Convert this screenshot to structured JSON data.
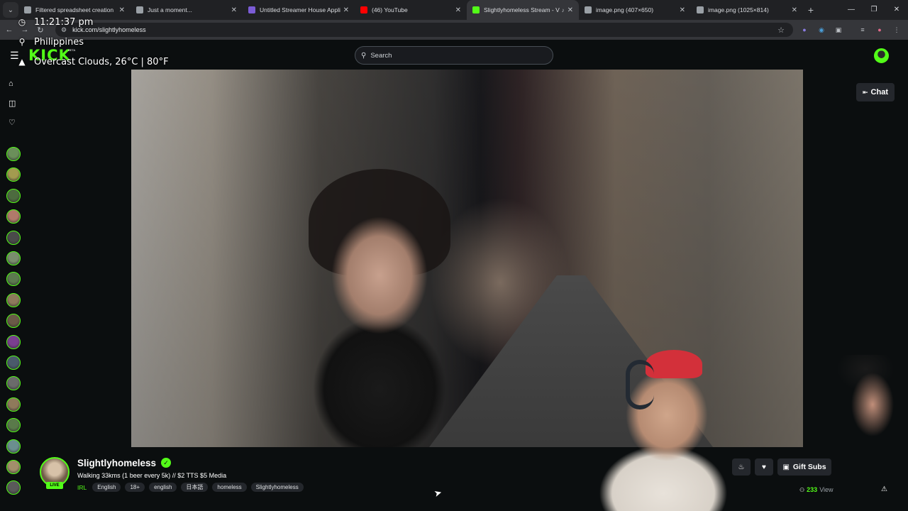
{
  "browser": {
    "tabs": [
      {
        "title": "Filtered spreadsheet creation",
        "favicon_color": "#9aa0a6"
      },
      {
        "title": "Just a moment...",
        "favicon_color": "#9aa0a6"
      },
      {
        "title": "Untitled Streamer House Appli",
        "favicon_color": "#7b5cd6"
      },
      {
        "title": "(46) YouTube",
        "favicon_color": "#ff0000"
      },
      {
        "title": "Slightlyhomeless Stream - V",
        "favicon_color": "#53fc18",
        "active": true
      },
      {
        "title": "image.png (407×650)",
        "favicon_color": "#9aa0a6"
      },
      {
        "title": "image.png (1025×814)",
        "favicon_color": "#9aa0a6"
      }
    ],
    "url": "kick.com/slightlyhomeless"
  },
  "overlay": {
    "time": "11:21:37 pm",
    "location": "Philippines",
    "weather": "Overcast Clouds, 26°C | 80°F"
  },
  "header": {
    "logo": "KICK",
    "beta": "BETA",
    "search_placeholder": "Search"
  },
  "sidebar": {
    "follow_colors": [
      "#6b8f5a",
      "#a39b4f",
      "#4d6b3f",
      "#b07a6a",
      "#4a4a4a",
      "#7a8d6e",
      "#5c7a4f",
      "#8e7a5b",
      "#6a5a47",
      "#7a3f8f",
      "#4a5a6b",
      "#6b6b6b",
      "#8f7a5b",
      "#5a7a4a",
      "#6b8f8f",
      "#a38f6b",
      "#5a5a5a"
    ]
  },
  "video_controls": {
    "chat_label": "Chat"
  },
  "stream": {
    "channel": "Slightlyhomeless",
    "live": "LIVE",
    "title": "Walking 33kms (1 beer every 5k) //  $2 TTS $5 Media",
    "category": "IRL",
    "tags": [
      "English",
      "18+",
      "english",
      "日本語",
      "homeless",
      "Slightlyhomeless"
    ],
    "gift_label": "Gift Subs",
    "viewer_count": "233",
    "viewer_label": "View"
  },
  "colors": {
    "accent": "#53fc18",
    "background": "#0b0e0f",
    "button": "#24272c"
  }
}
